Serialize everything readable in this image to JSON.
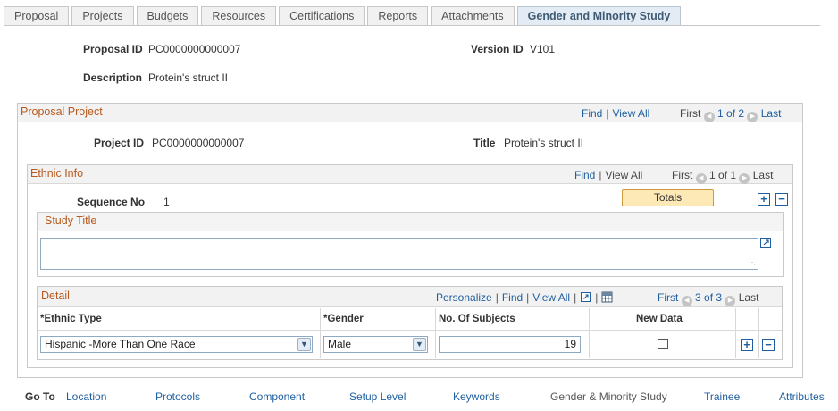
{
  "tabs": [
    {
      "label": "Proposal",
      "active": false
    },
    {
      "label": "Projects",
      "active": false
    },
    {
      "label": "Budgets",
      "active": false
    },
    {
      "label": "Resources",
      "active": false
    },
    {
      "label": "Certifications",
      "active": false
    },
    {
      "label": "Reports",
      "active": false
    },
    {
      "label": "Attachments",
      "active": false
    },
    {
      "label": "Gender and Minority Study",
      "active": true
    }
  ],
  "header": {
    "proposal_id_label": "Proposal ID",
    "proposal_id": "PC0000000000007",
    "version_id_label": "Version ID",
    "version_id": "V101",
    "description_label": "Description",
    "description": "Protein's struct II"
  },
  "proposal_project": {
    "title": "Proposal Project",
    "find": "Find",
    "view_all": "View All",
    "first": "First",
    "range": "1 of 2",
    "last": "Last",
    "project_id_label": "Project ID",
    "project_id": "PC0000000000007",
    "title_label": "Title",
    "title_value": "Protein's struct II"
  },
  "ethnic_info": {
    "title": "Ethnic Info",
    "find": "Find",
    "view_all": "View All",
    "first": "First",
    "range": "1 of 1",
    "last": "Last",
    "sequence_label": "Sequence No",
    "sequence_value": "1",
    "totals_label": "Totals"
  },
  "study_title": {
    "title": "Study Title",
    "value": ""
  },
  "detail": {
    "title": "Detail",
    "personalize": "Personalize",
    "find": "Find",
    "view_all": "View All",
    "first": "First",
    "range": "3 of 3",
    "last": "Last",
    "columns": {
      "ethnic_type": "*Ethnic Type",
      "gender": "*Gender",
      "subjects": "No. Of Subjects",
      "new_data": "New Data"
    },
    "rows": [
      {
        "ethnic_type": "Hispanic -More Than One Race",
        "gender": "Male",
        "subjects": "19",
        "new_data": false
      }
    ]
  },
  "goto": {
    "label": "Go To",
    "links": [
      "Location",
      "Protocols",
      "Component",
      "Setup Level",
      "Keywords",
      "Gender & Minority Study",
      "Trainee",
      "Attributes"
    ]
  },
  "colors": {
    "accent_link": "#1f5e9f",
    "section_title": "#b75a1c",
    "totals_button": "#fde9b6"
  },
  "icons": {
    "first_prev": "circle-left-arrow-icon",
    "next_last": "circle-right-arrow-icon",
    "zoom": "zoom-expand-icon",
    "grid": "grid-download-icon",
    "add": "plus-icon",
    "remove": "minus-icon"
  }
}
